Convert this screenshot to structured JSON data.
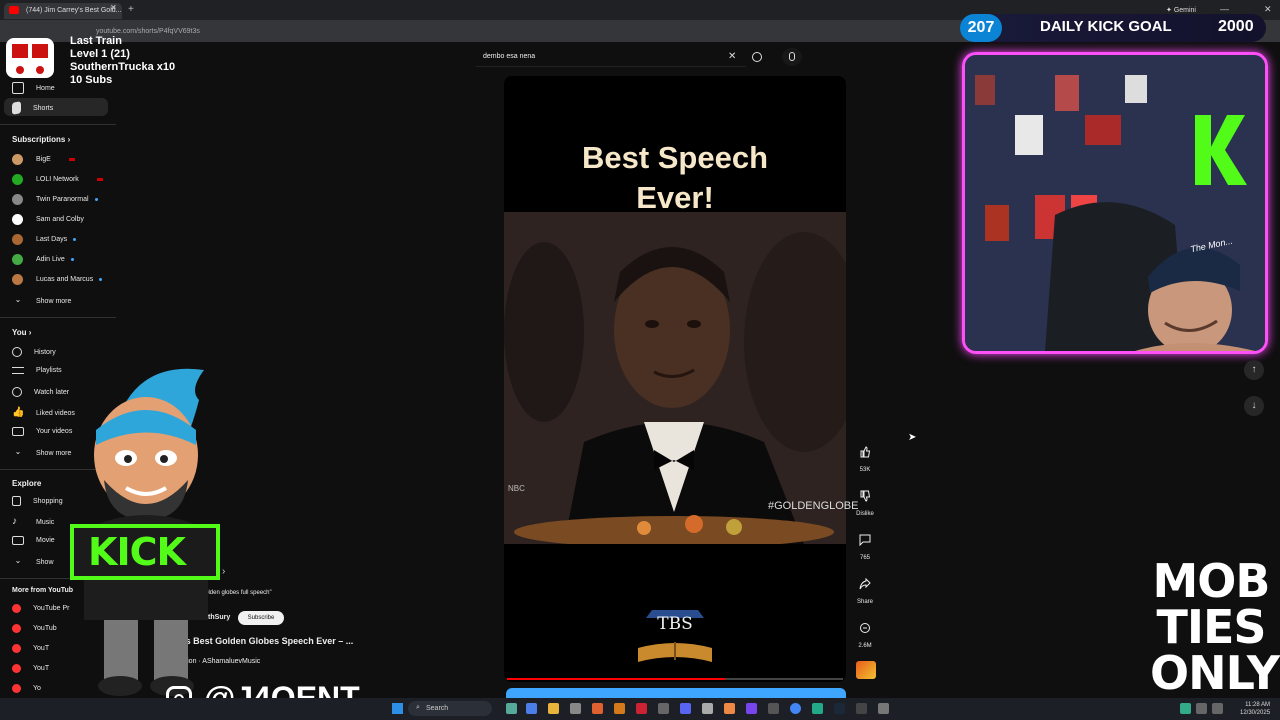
{
  "browser": {
    "tab_title": "(744) Jim Carrey's Best Gold...",
    "url": "youtube.com/shorts/P4fqVV69t3s",
    "gemini_label": "Gemini"
  },
  "sidebar": {
    "home": "Home",
    "shorts": "Shorts",
    "subscriptions_header": "Subscriptions",
    "subs": [
      {
        "name": "BigE",
        "indicator": "live",
        "color": "#c96"
      },
      {
        "name": "LOLI Network",
        "indicator": "live",
        "color": "#2a2"
      },
      {
        "name": "Twin Paranormal",
        "indicator": "dot",
        "color": "#888"
      },
      {
        "name": "Sam and Colby",
        "indicator": "none",
        "color": "#fff"
      },
      {
        "name": "Last Days",
        "indicator": "dot",
        "color": "#a63"
      },
      {
        "name": "Adin Live",
        "indicator": "dot",
        "color": "#4a4"
      },
      {
        "name": "Lucas and Marcus",
        "indicator": "dot",
        "color": "#b74"
      }
    ],
    "show_more_subs": "Show more",
    "you_header": "You",
    "you_items": [
      "History",
      "Playlists",
      "Watch later",
      "Liked videos",
      "Your videos"
    ],
    "show_more_you": "Show more",
    "explore_header": "Explore",
    "explore_items": [
      "Shopping",
      "Music",
      "Movie",
      "Show"
    ],
    "more_from_header": "More from YouTub",
    "more_from_items": [
      "YouTube Pr",
      "YouTub",
      "YouT",
      "YouT",
      "Yo"
    ]
  },
  "search": {
    "query": "dembo esa nena"
  },
  "video": {
    "title_line1": "Best Speech",
    "title_line2": "Ever!",
    "hashtag": "#GOLDENGLOBE",
    "logo_text": "TBS",
    "progress": 0.65,
    "nbc": "NBC"
  },
  "below_video": {
    "search_hint": "\"jim carrey golden globes full speech\"",
    "channel": "heBooksWithSury",
    "subscribe": "Subscribe",
    "title": "rey's Best Golden Globes Speech Ever – ...",
    "music": "spiration · AShamaluevMusic"
  },
  "actions": {
    "likes": "53K",
    "dislike": "Dislike",
    "comments": "765",
    "share": "Share",
    "remix": "2.6M"
  },
  "overlay": {
    "train_name": "Last Train",
    "train_level": "Level 1  (21)",
    "train_user": "SouthernTrucka x10",
    "train_subs": "10 Subs",
    "kick_count": "207",
    "kick_title": "DAILY KICK GOAL",
    "kick_goal": "2000",
    "kick_sign": "KICK",
    "cap_text": "The Mon...",
    "mob_lines": [
      "MOB",
      "TIES",
      "ONLY"
    ],
    "handle": "@J4OENT"
  },
  "taskbar": {
    "search": "Search",
    "time": "11:28 AM",
    "date": "12/30/2025"
  }
}
